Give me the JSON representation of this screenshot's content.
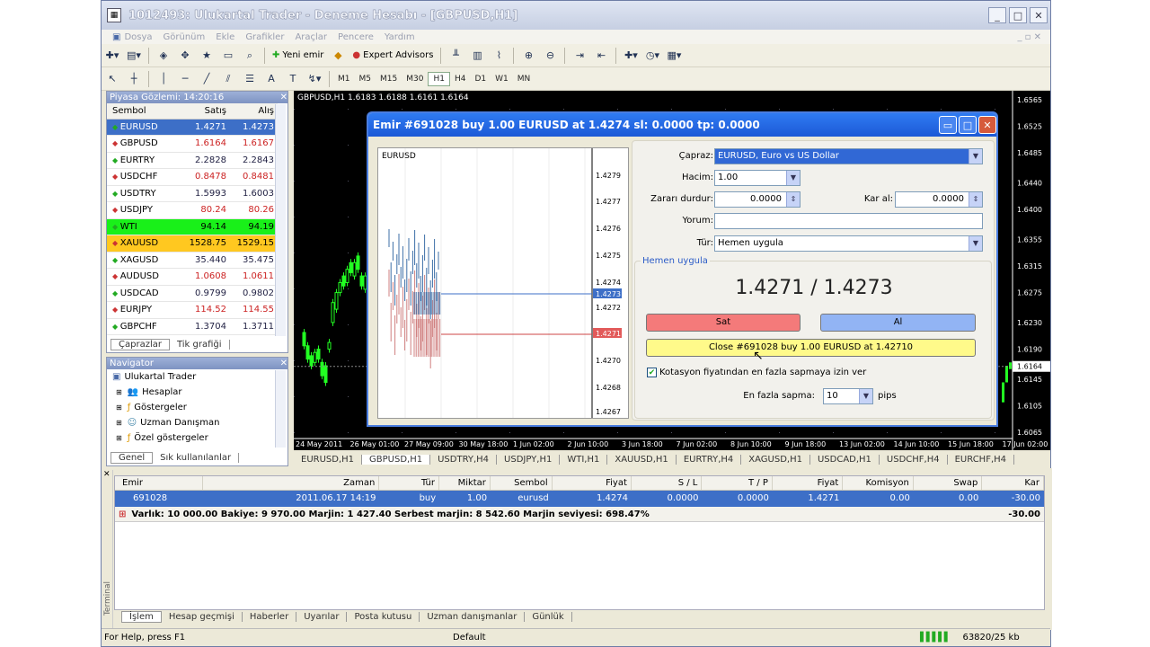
{
  "window": {
    "title": "1012493: Ulukartal Trader - Deneme Hesabı - [GBPUSD,H1]"
  },
  "menu": [
    "Dosya",
    "Görünüm",
    "Ekle",
    "Grafikler",
    "Araçlar",
    "Pencere",
    "Yardım"
  ],
  "toolbar": {
    "new_order": "Yeni emir",
    "expert": "Expert Advisors",
    "timeframes": [
      "M1",
      "M5",
      "M15",
      "M30",
      "H1",
      "H4",
      "D1",
      "W1",
      "MN"
    ]
  },
  "market_watch": {
    "title": "Piyasa Gözlemi: 14:20:16",
    "headers": [
      "Sembol",
      "Satış",
      "Alış"
    ],
    "rows": [
      [
        "EURUSD",
        "1.4271",
        "1.4273"
      ],
      [
        "GBPUSD",
        "1.6164",
        "1.6167"
      ],
      [
        "EURTRY",
        "2.2828",
        "2.2843"
      ],
      [
        "USDCHF",
        "0.8478",
        "0.8481"
      ],
      [
        "USDTRY",
        "1.5993",
        "1.6003"
      ],
      [
        "USDJPY",
        "80.24",
        "80.26"
      ],
      [
        "WTI",
        "94.14",
        "94.19"
      ],
      [
        "XAUUSD",
        "1528.75",
        "1529.15"
      ],
      [
        "XAGUSD",
        "35.440",
        "35.475"
      ],
      [
        "AUDUSD",
        "1.0608",
        "1.0611"
      ],
      [
        "USDCAD",
        "0.9799",
        "0.9802"
      ],
      [
        "EURJPY",
        "114.52",
        "114.55"
      ],
      [
        "GBPCHF",
        "1.3704",
        "1.3711"
      ]
    ],
    "tabs": [
      "Çaprazlar",
      "Tik grafiği"
    ]
  },
  "navigator": {
    "title": "Navigator",
    "root": "Ulukartal Trader",
    "items": [
      "Hesaplar",
      "Göstergeler",
      "Uzman Danışman",
      "Özel göstergeler"
    ],
    "tabs": [
      "Genel",
      "Sık kullanılanlar"
    ]
  },
  "chart": {
    "header": "GBPUSD,H1  1.6183 1.6188 1.6161 1.6164",
    "prices": [
      "1.6565",
      "1.6525",
      "1.6485",
      "1.6440",
      "1.6400",
      "1.6355",
      "1.6315",
      "1.6275",
      "1.6230",
      "1.6190",
      "1.6164",
      "1.6145",
      "1.6105",
      "1.6065"
    ],
    "dates": [
      "24 May 2011",
      "26 May 01:00",
      "27 May 09:00",
      "30 May 18:00",
      "1 Jun 02:00",
      "2 Jun 10:00",
      "3 Jun 18:00",
      "7 Jun 02:00",
      "8 Jun 10:00",
      "9 Jun 18:00",
      "13 Jun 02:00",
      "14 Jun 10:00",
      "15 Jun 18:00",
      "17 Jun 02:00"
    ],
    "tabs": [
      "EURUSD,H1",
      "GBPUSD,H1",
      "USDTRY,H4",
      "USDJPY,H1",
      "WTI,H1",
      "XAUUSD,H1",
      "EURTRY,H4",
      "XAGUSD,H1",
      "USDCAD,H1",
      "USDCHF,H4",
      "EURCHF,H4"
    ]
  },
  "dialog": {
    "title": "Emir #691028 buy 1.00 EURUSD at 1.4274 sl: 0.0000 tp: 0.0000",
    "mini": {
      "symbol": "EURUSD",
      "prices": [
        "1.4279",
        "1.4277",
        "1.4276",
        "1.4275",
        "1.4274",
        "1.4273",
        "1.4272",
        "1.4271",
        "1.4270",
        "1.4268",
        "1.4267"
      ]
    },
    "symbol_label": "Çapraz:",
    "symbol": "EURUSD, Euro vs US Dollar",
    "volume_label": "Hacim:",
    "volume": "1.00",
    "sl_label": "Zararı durdur:",
    "sl": "0.0000",
    "tp_label": "Kar al:",
    "tp": "0.0000",
    "comment_label": "Yorum:",
    "type_label": "Tür:",
    "type": "Hemen uygula",
    "group": "Hemen uygula",
    "quote": "1.4271 / 1.4273",
    "sell": "Sat",
    "buy": "Al",
    "close": "Close #691028 buy 1.00 EURUSD at 1.42710",
    "deviation_chk": "Kotasyon fiyatından en fazla sapmaya izin ver",
    "dev_label": "En fazla sapma:",
    "dev": "10",
    "pips": "pips"
  },
  "terminal": {
    "headers": [
      "Emir",
      "Zaman",
      "Tür",
      "Miktar",
      "Sembol",
      "Fiyat",
      "S / L",
      "T / P",
      "Fiyat",
      "Komisyon",
      "Swap",
      "Kar"
    ],
    "row": [
      "691028",
      "2011.06.17 14:19",
      "buy",
      "1.00",
      "eurusd",
      "1.4274",
      "0.0000",
      "0.0000",
      "1.4271",
      "0.00",
      "0.00",
      "-30.00"
    ],
    "summary": "Varlık: 10 000.00  Bakiye: 9 970.00  Marjin: 1 427.40  Serbest marjin: 8 542.60  Marjin seviyesi: 698.47%",
    "summary_pl": "-30.00",
    "tabs": [
      "İşlem",
      "Hesap geçmişi",
      "Haberler",
      "Uyarılar",
      "Posta kutusu",
      "Uzman danışmanlar",
      "Günlük"
    ],
    "side": "Terminal"
  },
  "status": {
    "help": "For Help, press F1",
    "profile": "Default",
    "traffic": "63820/25 kb"
  },
  "colors": {
    "sell": "#f47a7a",
    "buy": "#92b4f4",
    "close": "#fffa8a",
    "wti": "#19f019",
    "xau": "#ffc820"
  }
}
